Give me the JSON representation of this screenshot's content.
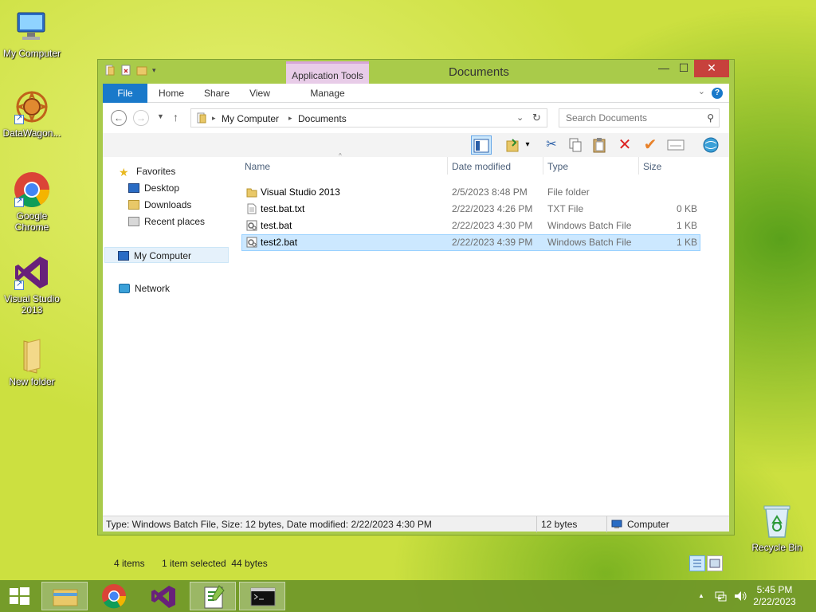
{
  "desktop": {
    "icons": [
      {
        "label": "My Computer"
      },
      {
        "label": "DataWagon..."
      },
      {
        "label": "Google Chrome"
      },
      {
        "label": "Visual Studio 2013"
      },
      {
        "label": "New folder"
      },
      {
        "label": "Recycle Bin"
      }
    ]
  },
  "window": {
    "title": "Documents",
    "contextual_tab_group": "Application Tools",
    "ribbon_tabs": [
      "File",
      "Home",
      "Share",
      "View",
      "Manage"
    ],
    "help": "?",
    "controls": {
      "minimize": "—",
      "maximize": "☐",
      "close": "✕"
    }
  },
  "address": {
    "crumbs": [
      "My Computer",
      "Documents"
    ],
    "separator": "▸",
    "search_placeholder": "Search Documents"
  },
  "navpane": {
    "favorites": "Favorites",
    "favorite_items": [
      "Desktop",
      "Downloads",
      "Recent places"
    ],
    "computer": "My Computer",
    "network": "Network"
  },
  "columns": [
    "Name",
    "Date modified",
    "Type",
    "Size"
  ],
  "files": [
    {
      "name": "Visual Studio 2013",
      "date": "2/5/2023 8:48 PM",
      "type": "File folder",
      "size": "",
      "kind": "folder"
    },
    {
      "name": "test.bat.txt",
      "date": "2/22/2023 4:26 PM",
      "type": "TXT File",
      "size": "0 KB",
      "kind": "text"
    },
    {
      "name": "test.bat",
      "date": "2/22/2023 4:30 PM",
      "type": "Windows Batch File",
      "size": "1 KB",
      "kind": "batch"
    },
    {
      "name": "test2.bat",
      "date": "2/22/2023 4:39 PM",
      "type": "Windows Batch File",
      "size": "1 KB",
      "kind": "batch",
      "selected": true
    }
  ],
  "status": {
    "items_count": "4 items",
    "selection": "1 item selected  44 bytes",
    "details": "Type: Windows Batch File, Size: 12 bytes, Date modified: 2/22/2023 4:30 PM",
    "size": "12 bytes",
    "location": "Computer"
  },
  "taskbar": {
    "time": "5:45 PM",
    "date": "2/22/2023",
    "tray_arrow": "▲"
  },
  "colors": {
    "accent": "#1979ca",
    "window_frame": "#a9cb4a",
    "selection": "#cce8ff",
    "close": "#c7413c"
  }
}
